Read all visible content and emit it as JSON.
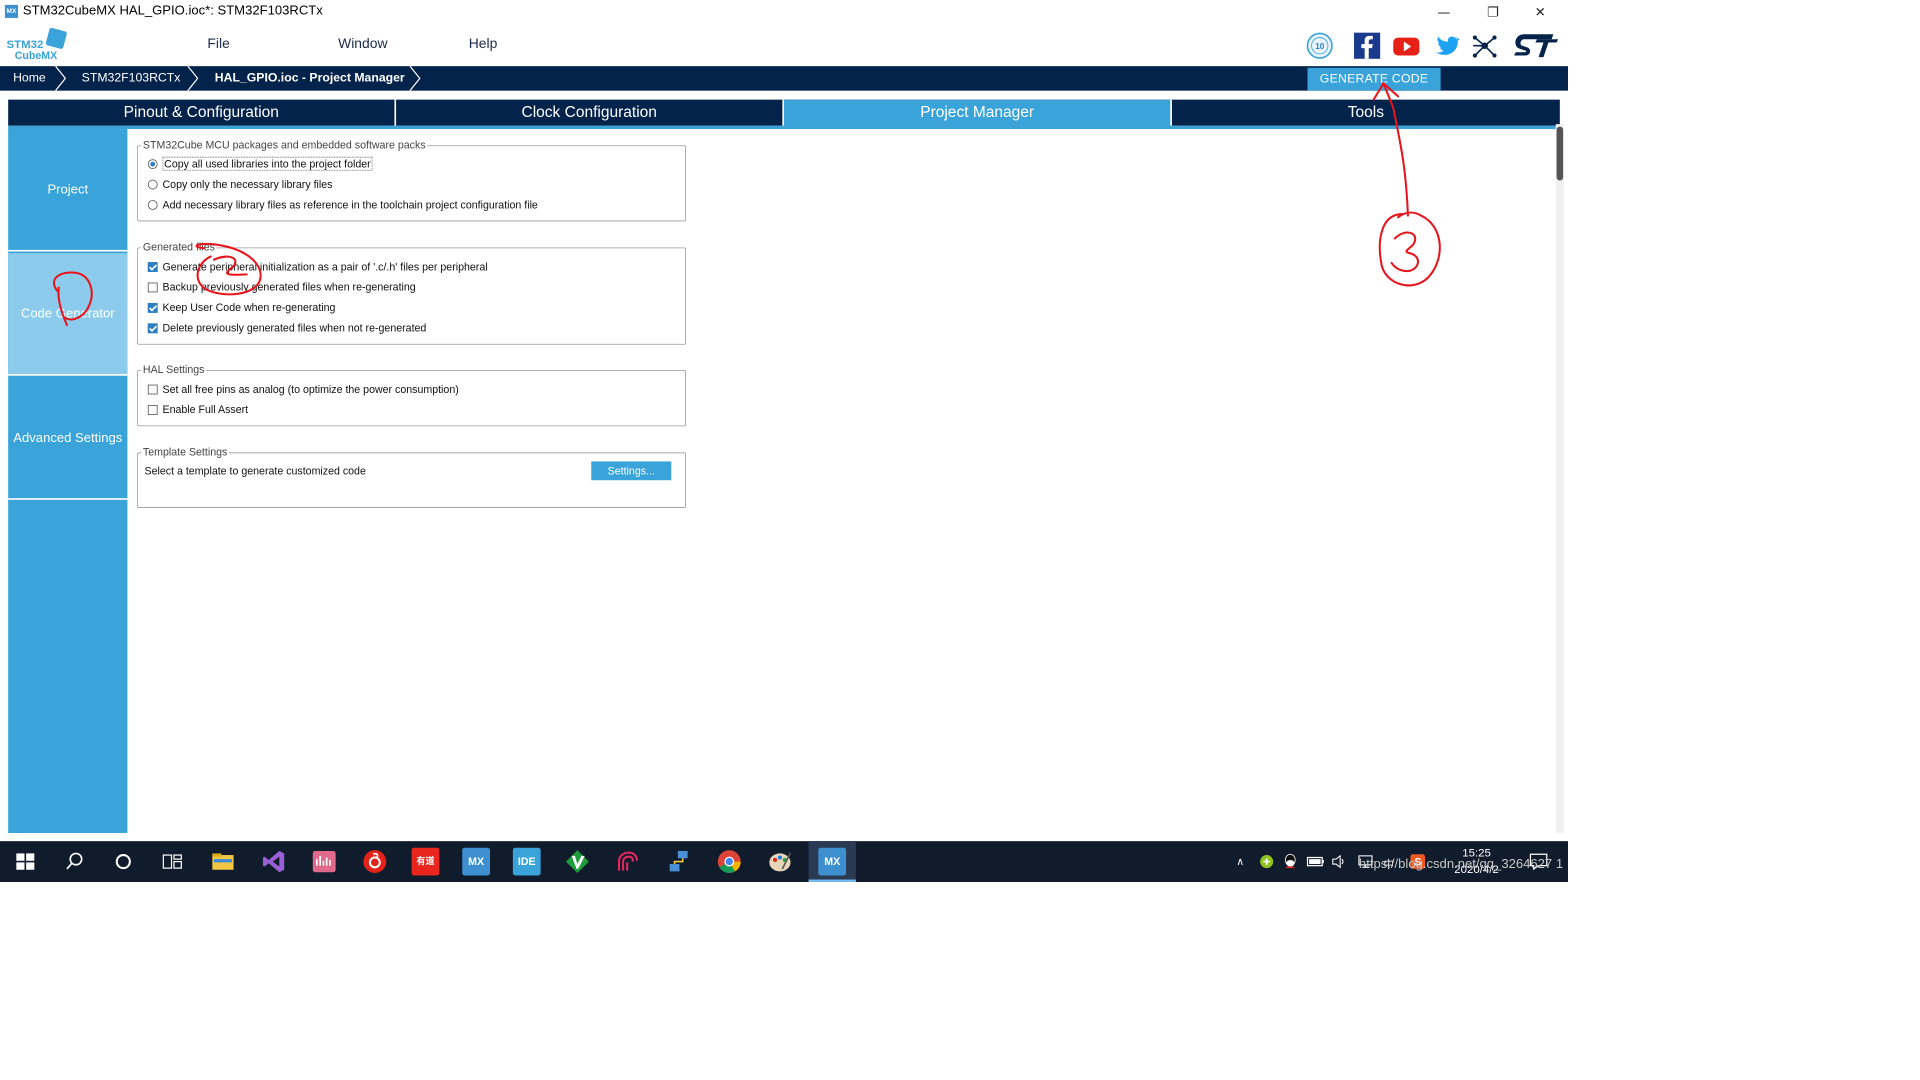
{
  "window": {
    "title": "STM32CubeMX HAL_GPIO.ioc*: STM32F103RCTx",
    "app_icon_text": "MX",
    "minimize": "—",
    "restore": "❐",
    "close": "✕"
  },
  "logo": {
    "line1": "STM32",
    "line2": "CubeMX"
  },
  "menu": {
    "file": "File",
    "window": "Window",
    "help": "Help"
  },
  "social_icons": [
    "anniversary-10-icon",
    "facebook-icon",
    "youtube-icon",
    "twitter-icon",
    "network-icon",
    "st-logo-icon"
  ],
  "breadcrumb": {
    "home": "Home",
    "mcu": "STM32F103RCTx",
    "current": "HAL_GPIO.ioc - Project Manager"
  },
  "generate_button": "GENERATE CODE",
  "tabs": [
    "Pinout & Configuration",
    "Clock Configuration",
    "Project Manager",
    "Tools"
  ],
  "active_tab": "Project Manager",
  "leftnav": [
    "Project",
    "Code Generator",
    "Advanced Settings"
  ],
  "active_nav": "Code Generator",
  "packs": {
    "legend": "STM32Cube MCU packages and embedded software packs",
    "options": [
      {
        "label": "Copy all used libraries into the project folder",
        "selected": true
      },
      {
        "label": "Copy only the necessary library files",
        "selected": false
      },
      {
        "label": "Add necessary library files as reference in the toolchain project configuration file",
        "selected": false
      }
    ]
  },
  "generated_files": {
    "legend": "Generated files",
    "options": [
      {
        "label": "Generate peripheral initialization as a pair of '.c/.h' files per peripheral",
        "checked": true
      },
      {
        "label": "Backup previously generated files when re-generating",
        "checked": false
      },
      {
        "label": "Keep User Code when re-generating",
        "checked": true
      },
      {
        "label": "Delete previously generated files when not re-generated",
        "checked": true
      }
    ]
  },
  "hal_settings": {
    "legend": "HAL Settings",
    "options": [
      {
        "label": "Set all free pins as analog (to optimize the power consumption)",
        "checked": false
      },
      {
        "label": "Enable Full Assert",
        "checked": false
      }
    ]
  },
  "template_settings": {
    "legend": "Template Settings",
    "text": "Select a template to generate customized code",
    "button": "Settings..."
  },
  "annotations": [
    "1",
    "2",
    "3"
  ],
  "taskbar": {
    "apps": [
      "start-icon",
      "search-icon",
      "cortana-icon",
      "task-view-icon",
      "file-explorer-icon",
      "visual-studio-icon",
      "audio-app-icon",
      "netease-music-icon",
      "youdao-icon",
      "cubemx-icon",
      "cubeide-icon",
      "vim-icon",
      "app-icon",
      "network-app-icon",
      "chrome-icon",
      "paint-icon",
      "cubemx-active-icon"
    ],
    "app_texts": {
      "youdao": "有道",
      "mx": "MX",
      "ide": "IDE",
      "mx_active": "MX"
    },
    "time": "15:25",
    "date": "2020/4/2",
    "watermark": "https://blog.csdn.net/qq_3264627 1"
  },
  "colors": {
    "navy": "#03234b",
    "accent": "#3aa3da",
    "accent_light": "#8ccbeb",
    "annotation_red": "#e8141c"
  }
}
